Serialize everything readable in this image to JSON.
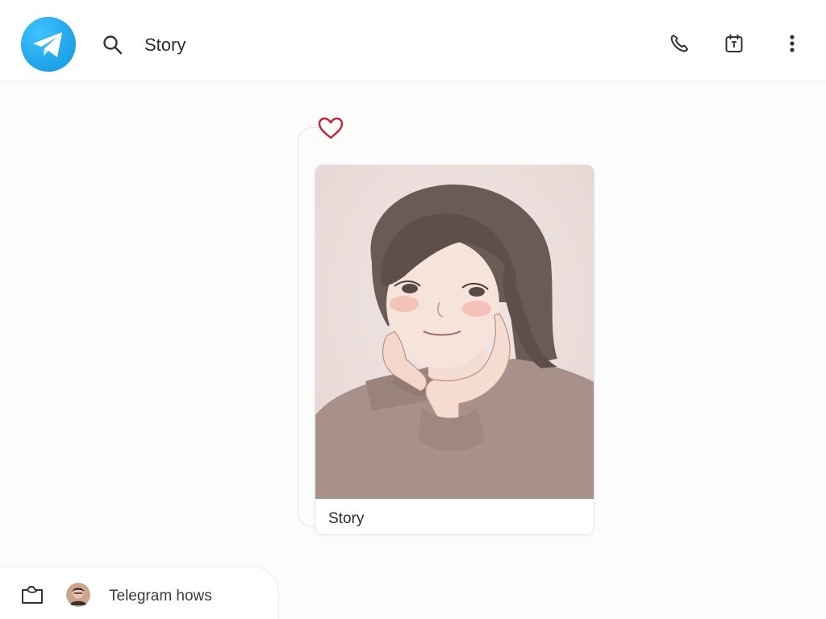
{
  "header": {
    "logo_icon": "telegram-plane-icon",
    "search_icon": "search-icon",
    "title": "Story",
    "actions": [
      {
        "icon": "phone-icon"
      },
      {
        "icon": "calendar-icon"
      },
      {
        "icon": "more-vertical-icon"
      }
    ]
  },
  "message": {
    "reaction_icon": "heart-icon",
    "story": {
      "image": "illustrated-portrait",
      "caption": "Story"
    }
  },
  "bottom_bar": {
    "attach_icon": "folder-icon",
    "avatar": "user-avatar",
    "label": "Telegram hows"
  },
  "colors": {
    "brand": "#22a6eb",
    "heart": "#c8202d",
    "background": "#fcfcfc"
  }
}
